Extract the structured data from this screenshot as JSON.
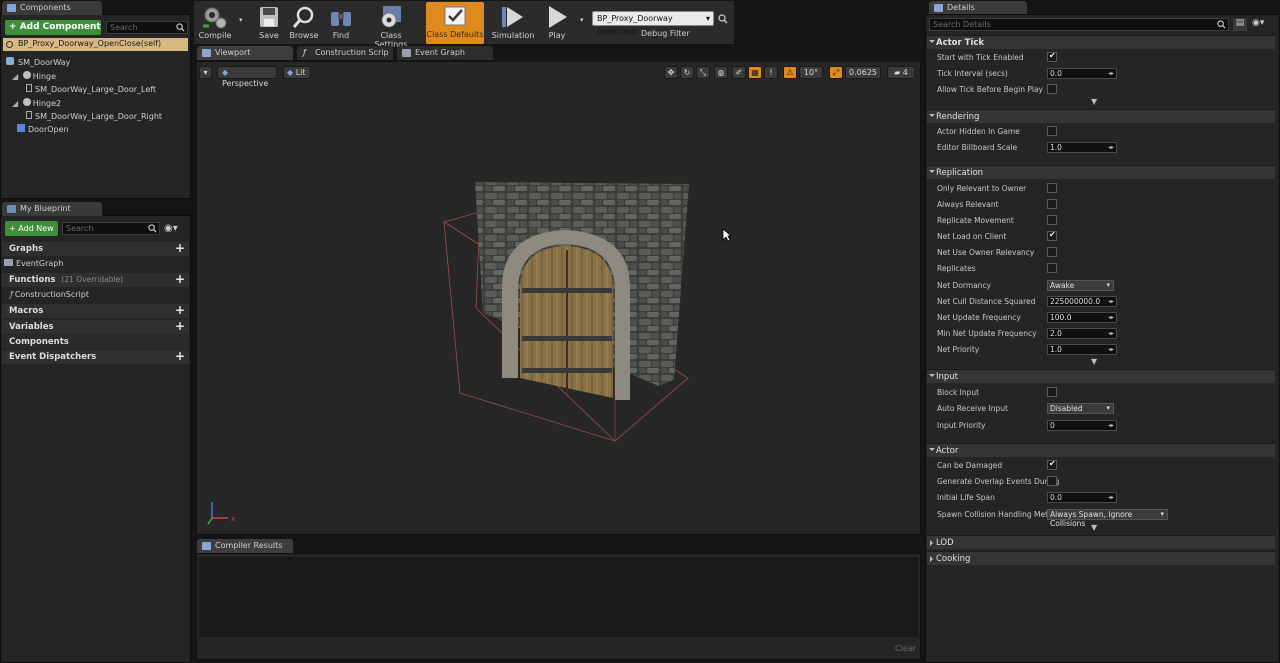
{
  "components_panel": {
    "tab": "Components",
    "add_button": "Add Component",
    "search_placeholder": "Search",
    "root_item": "BP_Proxy_Doorway_OpenClose(self)",
    "tree": [
      "SM_DoorWay",
      "Hinge",
      "SM_DoorWay_Large_Door_Left",
      "Hinge2",
      "SM_DoorWay_Large_Door_Right",
      "DoorOpen"
    ]
  },
  "blueprint_panel": {
    "tab": "My Blueprint",
    "add_button": "Add New",
    "search_placeholder": "Search",
    "sections": {
      "graphs": "Graphs",
      "event_graph": "EventGraph",
      "functions": "Functions",
      "functions_count": "(21 Overridable)",
      "construction_script": "ConstructionScript",
      "macros": "Macros",
      "variables": "Variables",
      "components": "Components",
      "event_dispatchers": "Event Dispatchers"
    }
  },
  "toolbar": {
    "compile": "Compile",
    "save": "Save",
    "browse": "Browse",
    "find": "Find",
    "class_settings": "Class Settings",
    "class_defaults": "Class Defaults",
    "simulation": "Simulation",
    "play": "Play",
    "debug_selected": "BP_Proxy_Doorway (selected)",
    "debug_filter": "Debug Filter"
  },
  "editor_tabs": {
    "viewport": "Viewport",
    "construction": "Construction Scrip",
    "event_graph": "Event Graph"
  },
  "viewport": {
    "perspective": "Perspective",
    "lit": "Lit",
    "rotation_snap": "10°",
    "scale_snap": "0.0625",
    "camera_speed": "4"
  },
  "compiler": {
    "tab": "Compiler Results",
    "clear": "Clear"
  },
  "details": {
    "tab": "Details",
    "search_placeholder": "Search Details",
    "categories": {
      "actor_tick": "Actor Tick",
      "rendering": "Rendering",
      "replication": "Replication",
      "input": "Input",
      "actor": "Actor",
      "lod": "LOD",
      "cooking": "Cooking"
    },
    "props": {
      "start_tick": "Start with Tick Enabled",
      "tick_interval": "Tick Interval (secs)",
      "tick_interval_val": "0.0",
      "allow_tick": "Allow Tick Before Begin Play",
      "hidden": "Actor Hidden In Game",
      "billboard": "Editor Billboard Scale",
      "billboard_val": "1.0",
      "only_relevant": "Only Relevant to Owner",
      "always_relevant": "Always Relevant",
      "replicate_movement": "Replicate Movement",
      "net_load": "Net Load on Client",
      "net_owner": "Net Use Owner Relevancy",
      "replicates": "Replicates",
      "dormancy": "Net Dormancy",
      "dormancy_val": "Awake",
      "cull": "Net Cull Distance Squared",
      "cull_val": "225000000.0",
      "update_freq": "Net Update Frequency",
      "update_freq_val": "100.0",
      "min_update": "Min Net Update Frequency",
      "min_update_val": "2.0",
      "priority": "Net Priority",
      "priority_val": "1.0",
      "block_input": "Block Input",
      "auto_receive": "Auto Receive Input",
      "auto_receive_val": "Disabled",
      "input_priority": "Input Priority",
      "input_priority_val": "0",
      "damaged": "Can be Damaged",
      "overlap": "Generate Overlap Events During",
      "life_span": "Initial Life Span",
      "life_span_val": "0.0",
      "spawn": "Spawn Collision Handling Metho",
      "spawn_val": "Always Spawn, Ignore Collisions"
    }
  },
  "colors": {
    "accent_orange": "#e08a1e",
    "add_green": "#3f8e3a",
    "selected_row": "#d8b882"
  }
}
